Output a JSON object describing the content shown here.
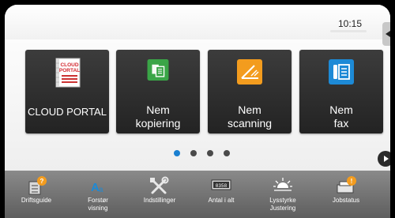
{
  "status_bar": {
    "time": "10:15"
  },
  "home_tiles": [
    {
      "label_lines": [
        "CLOUD PORTAL"
      ],
      "icon": "cloud-portal-icon",
      "icon_text": [
        "CLOUD",
        "PORTAL"
      ]
    },
    {
      "label_lines": [
        "Nem",
        "kopiering"
      ],
      "icon": "copy-icon",
      "color": "#3aa547"
    },
    {
      "label_lines": [
        "Nem",
        "scanning"
      ],
      "icon": "scan-icon",
      "color": "#f39c1e"
    },
    {
      "label_lines": [
        "Nem",
        "fax"
      ],
      "icon": "fax-icon",
      "color": "#1d8ad6"
    }
  ],
  "pager": {
    "pages": 4,
    "active": 1,
    "active_color": "#1a7fd0"
  },
  "system_bar": [
    {
      "label_lines": [
        "Driftsguide"
      ],
      "icon": "operation-guide-icon"
    },
    {
      "label_lines": [
        "Forstør",
        "visning"
      ],
      "icon": "enlarge-display-icon"
    },
    {
      "label_lines": [
        "Indstillinger"
      ],
      "icon": "settings-tools-icon"
    },
    {
      "label_lines": [
        "Antal i alt"
      ],
      "icon": "total-count-icon",
      "icon_text": "0358"
    },
    {
      "label_lines": [
        "Lysstyrke",
        "Justering"
      ],
      "icon": "brightness-icon"
    },
    {
      "label_lines": [
        "Jobstatus"
      ],
      "icon": "job-status-icon"
    }
  ]
}
